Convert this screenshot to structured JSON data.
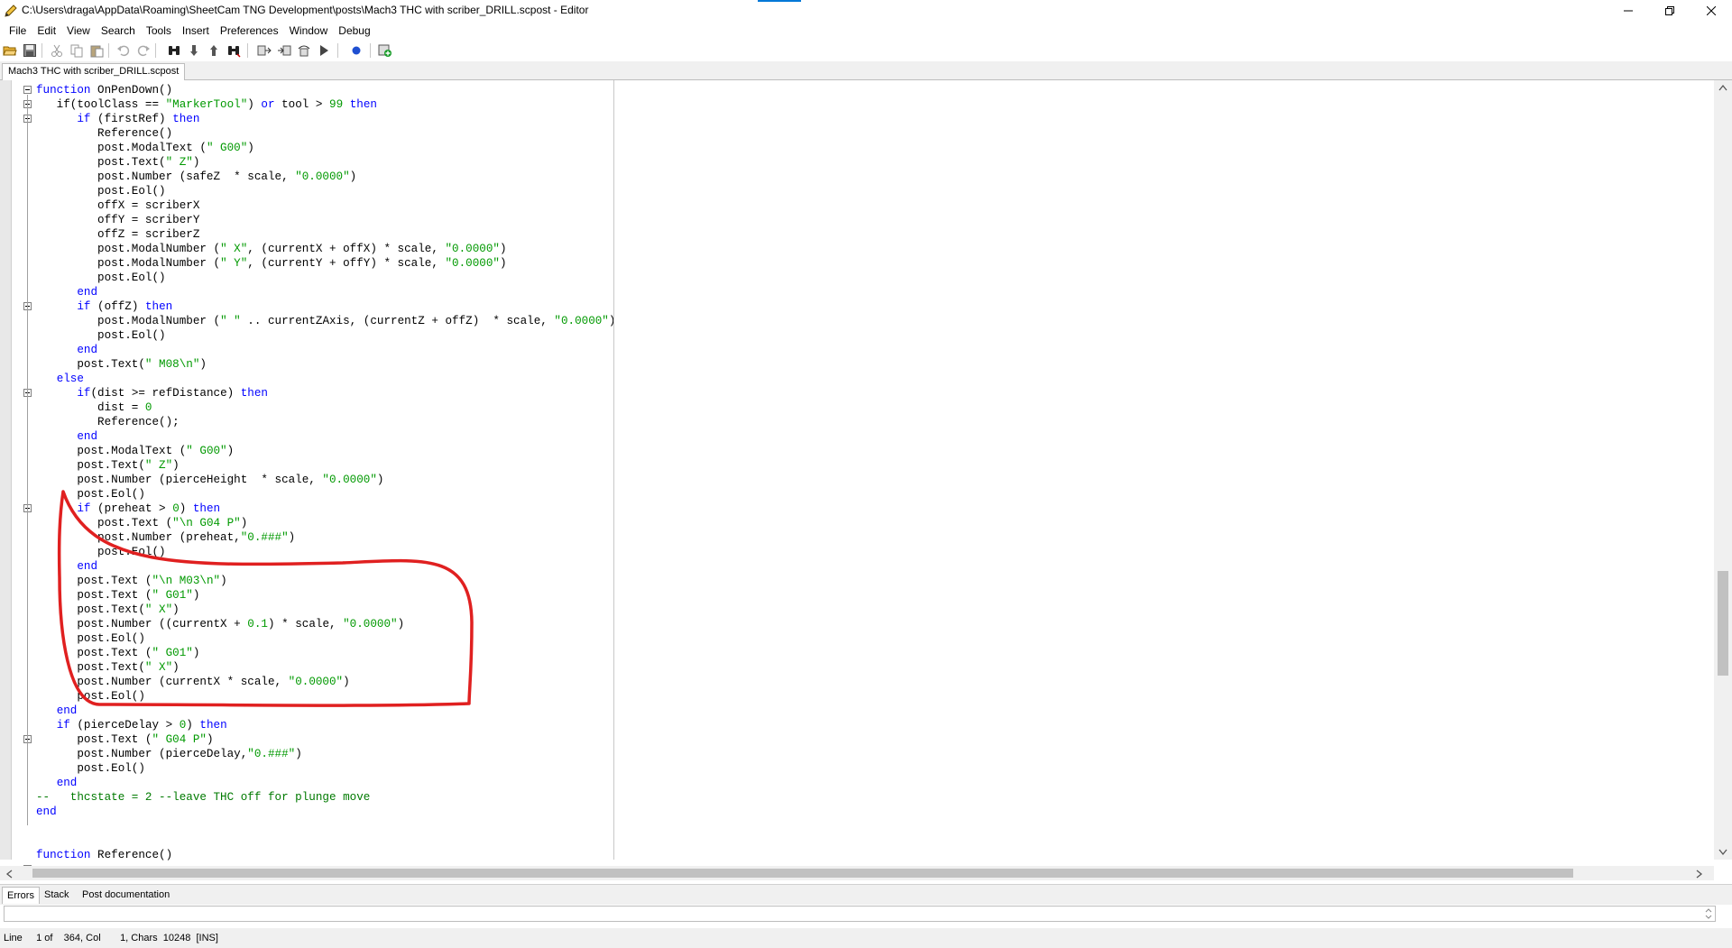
{
  "window": {
    "title": "C:\\Users\\draga\\AppData\\Roaming\\SheetCam TNG Development\\posts\\Mach3 THC with scriber_DRILL.scpost - Editor"
  },
  "menu": [
    "File",
    "Edit",
    "View",
    "Search",
    "Tools",
    "Insert",
    "Preferences",
    "Window",
    "Debug"
  ],
  "toolbar": [
    {
      "name": "open-file",
      "icon": "folder-open-icon"
    },
    {
      "name": "save",
      "icon": "save-icon"
    },
    {
      "name": "cut",
      "icon": "scissors-icon"
    },
    {
      "name": "copy",
      "icon": "copy-icon"
    },
    {
      "name": "paste",
      "icon": "paste-icon"
    },
    {
      "name": "undo",
      "icon": "undo-icon"
    },
    {
      "name": "redo",
      "icon": "redo-icon"
    },
    {
      "name": "find",
      "icon": "binoculars-icon"
    },
    {
      "name": "find-next",
      "icon": "find-next-icon"
    },
    {
      "name": "find-previous",
      "icon": "find-previous-icon"
    },
    {
      "name": "replace",
      "icon": "binoculars-icon"
    },
    {
      "name": "compile",
      "icon": "compile-icon"
    },
    {
      "name": "step",
      "icon": "step-icon"
    },
    {
      "name": "step-over",
      "icon": "step-over-icon"
    },
    {
      "name": "run",
      "icon": "play-icon"
    },
    {
      "name": "breakpoint",
      "icon": "breakpoint-icon"
    },
    {
      "name": "add-watch",
      "icon": "add-watch-icon"
    }
  ],
  "file_tab": "Mach3 THC with scriber_DRILL.scpost",
  "colors": {
    "keyword": "#0000ff",
    "string": "#009900",
    "annotation": "#e02020",
    "accent": "#0078d7"
  },
  "code_lines": [
    [
      [
        "k",
        "function"
      ],
      [
        "t",
        " OnPenDown()"
      ]
    ],
    [
      [
        "t",
        "   if(toolClass == "
      ],
      [
        "s",
        "\"MarkerTool\""
      ],
      [
        "t",
        ") "
      ],
      [
        "k",
        "or"
      ],
      [
        "t",
        " tool > "
      ],
      [
        "s",
        "99"
      ],
      [
        "t",
        " "
      ],
      [
        "k",
        "then"
      ]
    ],
    [
      [
        "t",
        "      "
      ],
      [
        "k",
        "if"
      ],
      [
        "t",
        " (firstRef) "
      ],
      [
        "k",
        "then"
      ]
    ],
    [
      [
        "t",
        "         Reference()"
      ]
    ],
    [
      [
        "t",
        "         post.ModalText ("
      ],
      [
        "s",
        "\" G00\""
      ],
      [
        "t",
        ")"
      ]
    ],
    [
      [
        "t",
        "         post.Text("
      ],
      [
        "s",
        "\" Z\""
      ],
      [
        "t",
        ")"
      ]
    ],
    [
      [
        "t",
        "         post.Number (safeZ  * scale, "
      ],
      [
        "s",
        "\"0.0000\""
      ],
      [
        "t",
        ")"
      ]
    ],
    [
      [
        "t",
        "         post.Eol()"
      ]
    ],
    [
      [
        "t",
        "         offX = scriberX"
      ]
    ],
    [
      [
        "t",
        "         offY = scriberY"
      ]
    ],
    [
      [
        "t",
        "         offZ = scriberZ"
      ]
    ],
    [
      [
        "t",
        "         post.ModalNumber ("
      ],
      [
        "s",
        "\" X\""
      ],
      [
        "t",
        ", (currentX + offX) * scale, "
      ],
      [
        "s",
        "\"0.0000\""
      ],
      [
        "t",
        ")"
      ]
    ],
    [
      [
        "t",
        "         post.ModalNumber ("
      ],
      [
        "s",
        "\" Y\""
      ],
      [
        "t",
        ", (currentY + offY) * scale, "
      ],
      [
        "s",
        "\"0.0000\""
      ],
      [
        "t",
        ")"
      ]
    ],
    [
      [
        "t",
        "         post.Eol()"
      ]
    ],
    [
      [
        "t",
        "      "
      ],
      [
        "k",
        "end"
      ]
    ],
    [
      [
        "t",
        "      "
      ],
      [
        "k",
        "if"
      ],
      [
        "t",
        " (offZ) "
      ],
      [
        "k",
        "then"
      ]
    ],
    [
      [
        "t",
        "         post.ModalNumber ("
      ],
      [
        "s",
        "\" \""
      ],
      [
        "t",
        " .. currentZAxis, (currentZ + offZ)  * scale, "
      ],
      [
        "s",
        "\"0.0000\""
      ],
      [
        "t",
        ")"
      ]
    ],
    [
      [
        "t",
        "         post.Eol()"
      ]
    ],
    [
      [
        "t",
        "      "
      ],
      [
        "k",
        "end"
      ]
    ],
    [
      [
        "t",
        "      post.Text("
      ],
      [
        "s",
        "\" M08\\n\""
      ],
      [
        "t",
        ")"
      ]
    ],
    [
      [
        "t",
        "   "
      ],
      [
        "k",
        "else"
      ]
    ],
    [
      [
        "t",
        "      "
      ],
      [
        "k",
        "if"
      ],
      [
        "t",
        "(dist >= refDistance) "
      ],
      [
        "k",
        "then"
      ]
    ],
    [
      [
        "t",
        "         dist = "
      ],
      [
        "s",
        "0"
      ]
    ],
    [
      [
        "t",
        "         Reference();"
      ]
    ],
    [
      [
        "t",
        "      "
      ],
      [
        "k",
        "end"
      ]
    ],
    [
      [
        "t",
        "      post.ModalText ("
      ],
      [
        "s",
        "\" G00\""
      ],
      [
        "t",
        ")"
      ]
    ],
    [
      [
        "t",
        "      post.Text("
      ],
      [
        "s",
        "\" Z\""
      ],
      [
        "t",
        ")"
      ]
    ],
    [
      [
        "t",
        "      post.Number (pierceHeight  * scale, "
      ],
      [
        "s",
        "\"0.0000\""
      ],
      [
        "t",
        ")"
      ]
    ],
    [
      [
        "t",
        "      post.Eol()"
      ]
    ],
    [
      [
        "t",
        "      "
      ],
      [
        "k",
        "if"
      ],
      [
        "t",
        " (preheat > "
      ],
      [
        "s",
        "0"
      ],
      [
        "t",
        ") "
      ],
      [
        "k",
        "then"
      ]
    ],
    [
      [
        "t",
        "         post.Text ("
      ],
      [
        "s",
        "\"\\n G04 P\""
      ],
      [
        "t",
        ")"
      ]
    ],
    [
      [
        "t",
        "         post.Number (preheat,"
      ],
      [
        "s",
        "\"0.###\""
      ],
      [
        "t",
        ")"
      ]
    ],
    [
      [
        "t",
        "         post.Eol()"
      ]
    ],
    [
      [
        "t",
        "      "
      ],
      [
        "k",
        "end"
      ]
    ],
    [
      [
        "t",
        "      post.Text ("
      ],
      [
        "s",
        "\"\\n M03\\n\""
      ],
      [
        "t",
        ")"
      ]
    ],
    [
      [
        "t",
        "      post.Text ("
      ],
      [
        "s",
        "\" G01\""
      ],
      [
        "t",
        ")"
      ]
    ],
    [
      [
        "t",
        "      post.Text("
      ],
      [
        "s",
        "\" X\""
      ],
      [
        "t",
        ")"
      ]
    ],
    [
      [
        "t",
        "      post.Number ((currentX + "
      ],
      [
        "s",
        "0.1"
      ],
      [
        "t",
        ") * scale, "
      ],
      [
        "s",
        "\"0.0000\""
      ],
      [
        "t",
        ")"
      ]
    ],
    [
      [
        "t",
        "      post.Eol()"
      ]
    ],
    [
      [
        "t",
        "      post.Text ("
      ],
      [
        "s",
        "\" G01\""
      ],
      [
        "t",
        ")"
      ]
    ],
    [
      [
        "t",
        "      post.Text("
      ],
      [
        "s",
        "\" X\""
      ],
      [
        "t",
        ")"
      ]
    ],
    [
      [
        "t",
        "      post.Number (currentX * scale, "
      ],
      [
        "s",
        "\"0.0000\""
      ],
      [
        "t",
        ")"
      ]
    ],
    [
      [
        "t",
        "      post.Eol()"
      ]
    ],
    [
      [
        "t",
        "   "
      ],
      [
        "k",
        "end"
      ]
    ],
    [
      [
        "t",
        "   "
      ],
      [
        "k",
        "if"
      ],
      [
        "t",
        " (pierceDelay > "
      ],
      [
        "s",
        "0"
      ],
      [
        "t",
        ") "
      ],
      [
        "k",
        "then"
      ]
    ],
    [
      [
        "t",
        "      post.Text ("
      ],
      [
        "s",
        "\" G04 P\""
      ],
      [
        "t",
        ")"
      ]
    ],
    [
      [
        "t",
        "      post.Number (pierceDelay,"
      ],
      [
        "s",
        "\"0.###\""
      ],
      [
        "t",
        ")"
      ]
    ],
    [
      [
        "t",
        "      post.Eol()"
      ]
    ],
    [
      [
        "t",
        "   "
      ],
      [
        "k",
        "end"
      ]
    ],
    [
      [
        "c",
        "--   thcstate = 2 --leave THC off for plunge move"
      ]
    ],
    [
      [
        "k",
        "end"
      ]
    ],
    [
      [
        "t",
        ""
      ]
    ],
    [
      [
        "t",
        ""
      ]
    ],
    [
      [
        "k",
        "function"
      ],
      [
        "t",
        " Reference()"
      ]
    ]
  ],
  "fold_markers": [
    0,
    1,
    2,
    15,
    21,
    29,
    45,
    54
  ],
  "bottom_tabs": [
    "Errors",
    "Stack",
    "Post documentation"
  ],
  "status": {
    "line_label": "Line",
    "line": "1 of",
    "total_lines": "364, Col",
    "col": "1, Chars",
    "chars": "10248",
    "mode": "[INS]"
  }
}
